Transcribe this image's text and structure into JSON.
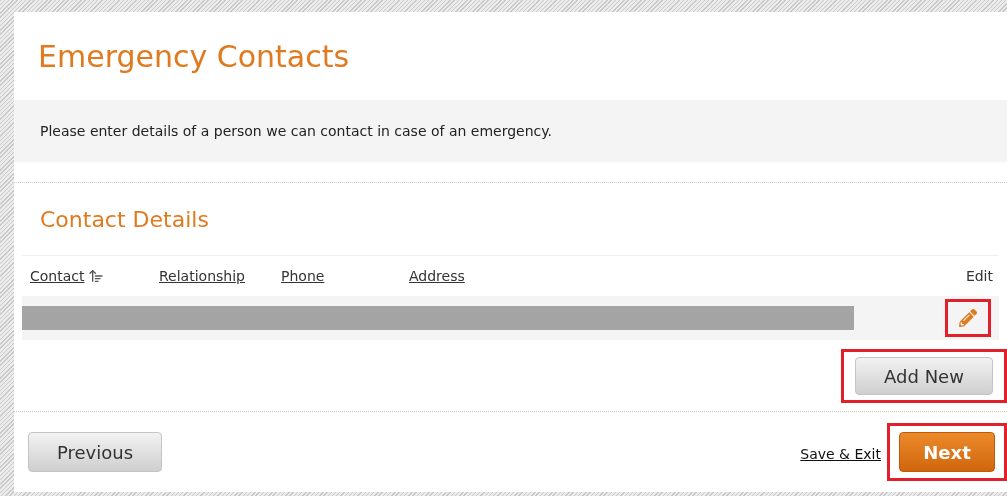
{
  "page_title": "Emergency Contacts",
  "intro": "Please enter details of a person we can contact in case of an emergency.",
  "section_title": "Contact Details",
  "table": {
    "columns": [
      {
        "label": "Contact",
        "sorted": true
      },
      {
        "label": "Relationship",
        "sorted": false
      },
      {
        "label": "Phone",
        "sorted": false
      },
      {
        "label": "Address",
        "sorted": false
      },
      {
        "label": "Edit",
        "sorted": false
      }
    ],
    "rows": [
      {
        "redacted": true,
        "edit_highlighted": true
      }
    ]
  },
  "add_button": {
    "label": "Add New",
    "highlighted": true
  },
  "footer": {
    "previous": {
      "label": "Previous",
      "highlighted": false
    },
    "save_link": "Save & Exit",
    "next": {
      "label": "Next",
      "highlighted": true
    }
  }
}
